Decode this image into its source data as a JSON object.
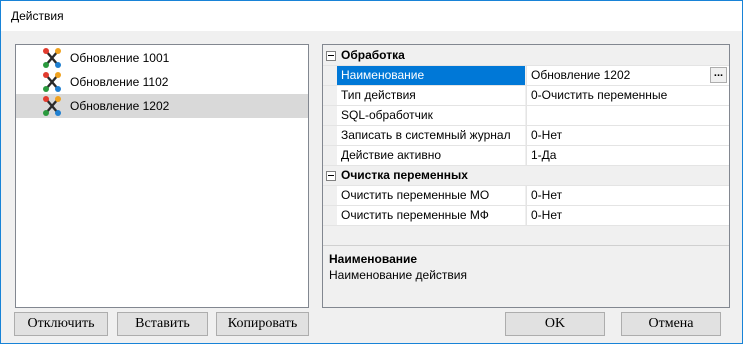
{
  "window": {
    "title": "Действия"
  },
  "tree": {
    "items": [
      {
        "label": "Обновление 1001",
        "selected": false
      },
      {
        "label": "Обновление 1102",
        "selected": false
      },
      {
        "label": "Обновление 1202",
        "selected": true
      }
    ]
  },
  "properties": {
    "categories": [
      {
        "label": "Обработка",
        "rows": [
          {
            "name": "Наименование",
            "value": "Обновление 1202",
            "selected": true
          },
          {
            "name": "Тип действия",
            "value": "0-Очистить переменные"
          },
          {
            "name": "SQL-обработчик",
            "value": ""
          },
          {
            "name": "Записать в системный журнал",
            "value": "0-Нет"
          },
          {
            "name": "Действие активно",
            "value": "1-Да"
          }
        ]
      },
      {
        "label": "Очистка переменных",
        "rows": [
          {
            "name": "Очистить переменные МО",
            "value": "0-Нет"
          },
          {
            "name": "Очистить переменные МФ",
            "value": "0-Нет"
          }
        ]
      }
    ],
    "ellipsis_label": "...",
    "description": {
      "title": "Наименование",
      "text": "Наименование действия"
    }
  },
  "buttons": {
    "disable": "Отключить",
    "insert": "Вставить",
    "copy": "Копировать",
    "ok": "OK",
    "cancel": "Отмена"
  },
  "colors": {
    "selection_accent": "#0078d7",
    "window_border": "#1883d7"
  },
  "icons": {
    "tree_item": "action-nodes-icon",
    "category_toggle": "collapse-minus-icon"
  }
}
